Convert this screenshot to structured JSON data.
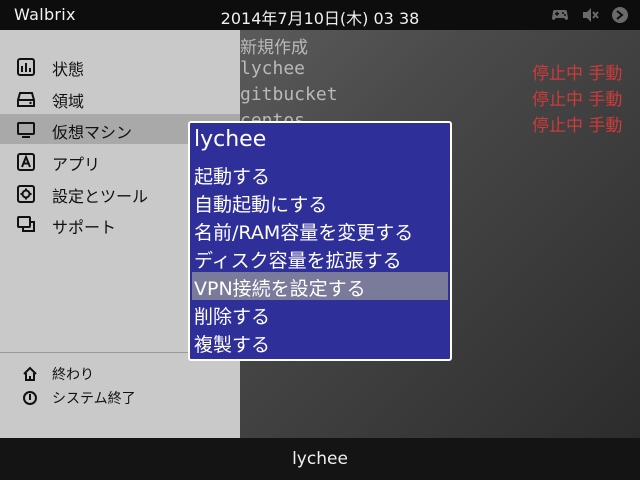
{
  "topbar": {
    "brand": "Walbrix",
    "datetime": "2014年7月10日(木) 03 38",
    "tray_icons": [
      "gamepad-icon",
      "volume-mute-icon",
      "network-icon"
    ]
  },
  "sidebar": {
    "items": [
      {
        "label": "状態",
        "icon": "chart-icon"
      },
      {
        "label": "領域",
        "icon": "drive-icon"
      },
      {
        "label": "仮想マシン",
        "icon": "monitor-icon"
      },
      {
        "label": "アプリ",
        "icon": "app-icon"
      },
      {
        "label": "設定とツール",
        "icon": "gear-icon"
      },
      {
        "label": "サポート",
        "icon": "chat-icon"
      }
    ],
    "selected_index": 2,
    "bottom_items": [
      {
        "label": "終わり",
        "icon": "home-icon"
      },
      {
        "label": "システム終了",
        "icon": "power-icon"
      }
    ]
  },
  "main": {
    "rows": [
      {
        "name": "新規作成",
        "status": ""
      },
      {
        "name": "lychee",
        "status": "停止中 手動"
      },
      {
        "name": "gitbucket",
        "status": "停止中 手動"
      },
      {
        "name": "centos",
        "status": "停止中 手動"
      }
    ]
  },
  "menu": {
    "title": "lychee",
    "items": [
      "起動する",
      "自動起動にする",
      "名前/RAM容量を変更する",
      "ディスク容量を拡張する",
      "VPN接続を設定する",
      "削除する",
      "複製する"
    ],
    "highlighted_index": 4
  },
  "statusbar": {
    "text": "lychee"
  },
  "colors": {
    "menu_bg": "#2f2f9a",
    "menu_highlight": "#7a7a9a",
    "status_red": "#d03a3a",
    "sidebar_bg": "#c9c9c9"
  }
}
